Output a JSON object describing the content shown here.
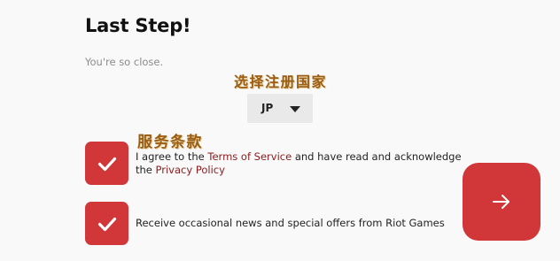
{
  "heading": "Last Step!",
  "subheading": "You're so close.",
  "annotations": {
    "country": "选择注册国家",
    "tos": "服务条款"
  },
  "country_select": {
    "value": "JP"
  },
  "agreements": [
    {
      "checked": true,
      "text_before": "I agree to the ",
      "tos_link": "Terms of Service",
      "text_middle": " and have read and acknowledge the ",
      "privacy_link": "Privacy Policy"
    },
    {
      "checked": true,
      "text": "Receive occasional news and special offers from Riot Games"
    }
  ],
  "next_button": {
    "icon": "arrow-right-icon"
  },
  "colors": {
    "accent": "#d13639",
    "link": "#8a1e20",
    "annotation": "#9a5d12",
    "background": "#f9f9f9"
  }
}
